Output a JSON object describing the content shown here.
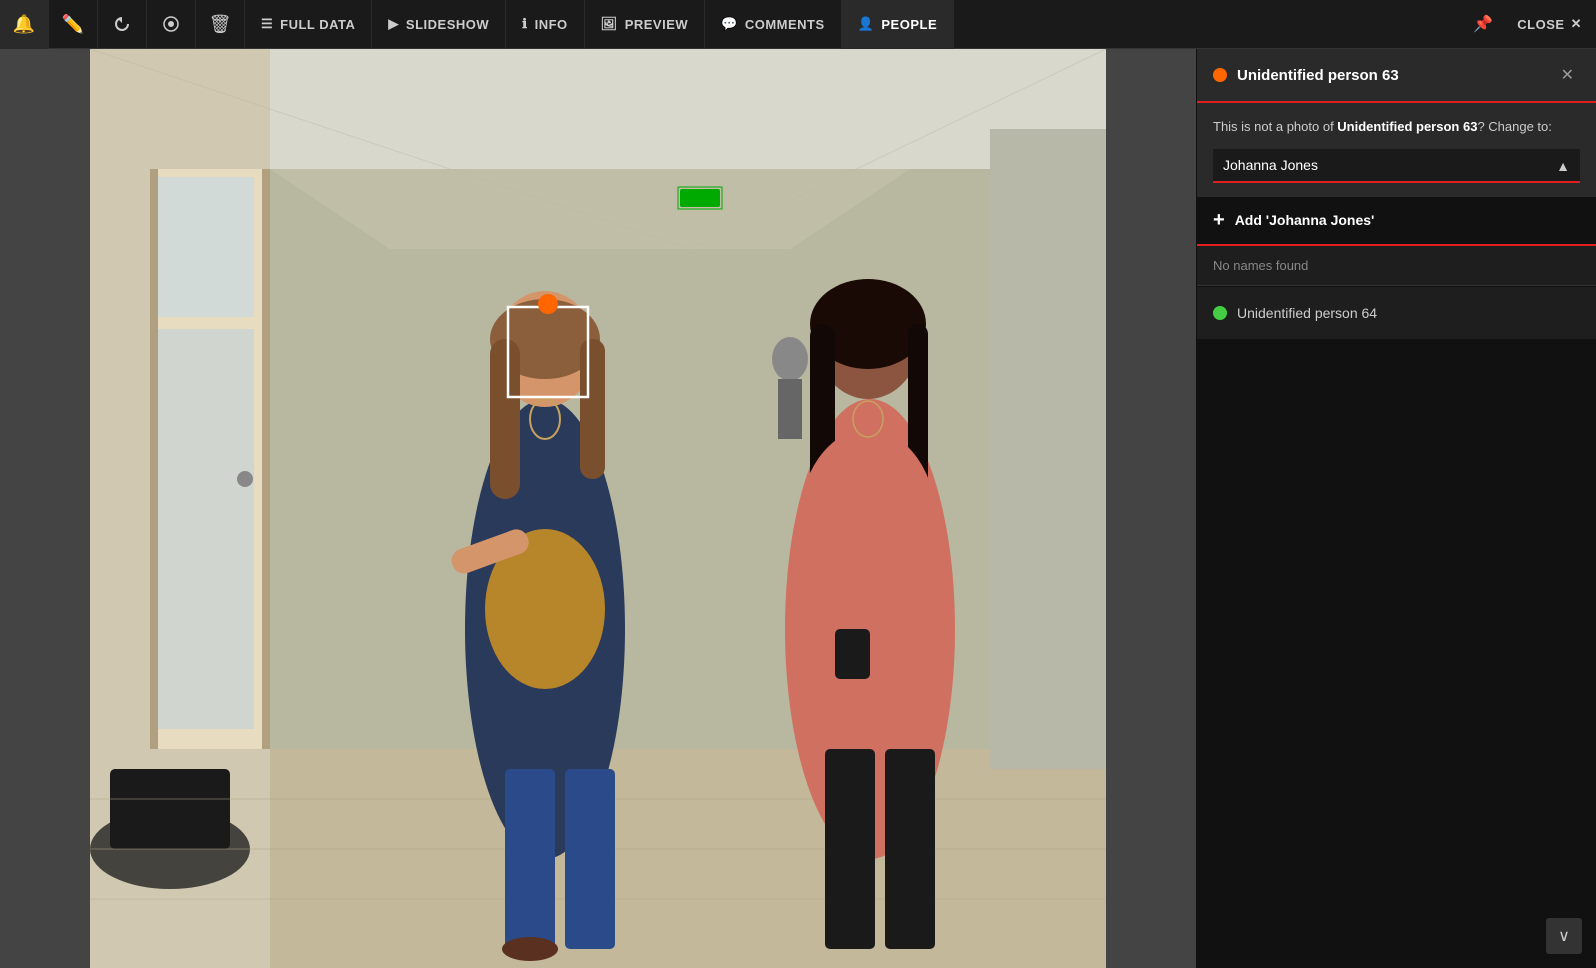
{
  "toolbar": {
    "icons": [
      {
        "name": "bell-icon",
        "symbol": "🔔"
      },
      {
        "name": "pencil-icon",
        "symbol": "✏️"
      },
      {
        "name": "history-icon",
        "symbol": "↺"
      },
      {
        "name": "tag-icon",
        "symbol": "◈"
      },
      {
        "name": "trash-icon",
        "symbol": "🗑"
      }
    ],
    "buttons": [
      {
        "name": "full-data-btn",
        "label": "FULL DATA",
        "icon": "☰",
        "active": false
      },
      {
        "name": "slideshow-btn",
        "label": "SLIDESHOW",
        "icon": "▶",
        "active": false
      },
      {
        "name": "info-btn",
        "label": "INFO",
        "icon": "ℹ",
        "active": false
      },
      {
        "name": "preview-btn",
        "label": "PREVIEW",
        "icon": "🖼",
        "active": false
      },
      {
        "name": "comments-btn",
        "label": "COMMENTS",
        "icon": "💬",
        "active": false
      },
      {
        "name": "people-btn",
        "label": "PEOPLE",
        "icon": "👤",
        "active": true
      }
    ],
    "pin_icon": "📌",
    "close_label": "CLOSE"
  },
  "right_panel": {
    "person1": {
      "name": "Unidentified person 63",
      "dot_color": "orange",
      "change_text": "This is not a photo of ",
      "change_name": "Unidentified person 63",
      "change_suffix": "? Change to:",
      "name_input_value": "Johanna Jones",
      "name_input_placeholder": "Johanna Jones",
      "add_button_label": "Add 'Johanna Jones'",
      "no_names_text": "No names found"
    },
    "person2": {
      "name": "Unidentified person 64",
      "dot_color": "green"
    },
    "scroll_down_icon": "∨"
  }
}
